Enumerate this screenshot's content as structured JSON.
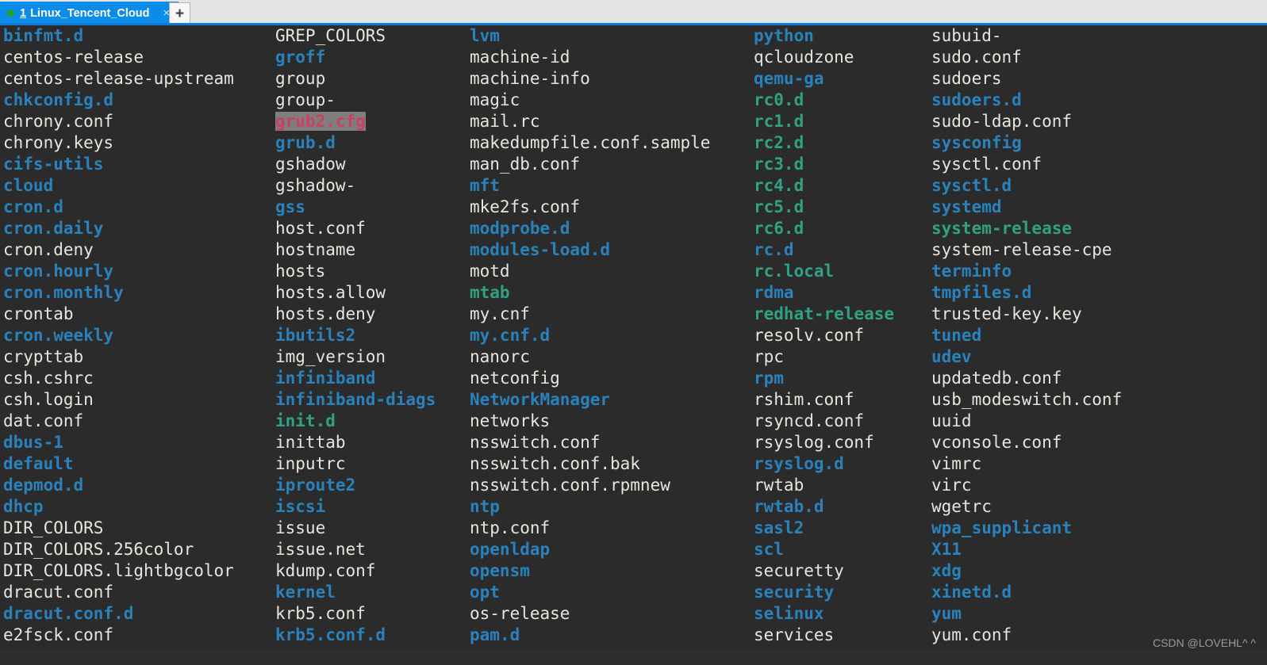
{
  "window": {
    "tab": {
      "index": "1",
      "title": "Linux_Tencent_Cloud",
      "close_label": "×",
      "status_dot_color": "#21a321"
    },
    "new_tab_label": "+",
    "accent_color": "#1179d6",
    "tabbar_bg": "#e4e4e4",
    "active_tab_bg": "#0c8ce9"
  },
  "terminal": {
    "background": "#2b2b2b",
    "colors": {
      "file": "#e9e5dd",
      "directory": "#2a82bc",
      "symlink": "#31a183",
      "orphan_text": "#c8415f",
      "orphan_background": "#7e7e7e"
    },
    "columns": [
      {
        "id": "column-1",
        "entries": [
          {
            "name": "binfmt.d",
            "type": "dir"
          },
          {
            "name": "centos-release",
            "type": "file"
          },
          {
            "name": "centos-release-upstream",
            "type": "file"
          },
          {
            "name": "chkconfig.d",
            "type": "dir"
          },
          {
            "name": "chrony.conf",
            "type": "file"
          },
          {
            "name": "chrony.keys",
            "type": "file"
          },
          {
            "name": "cifs-utils",
            "type": "dir"
          },
          {
            "name": "cloud",
            "type": "dir"
          },
          {
            "name": "cron.d",
            "type": "dir"
          },
          {
            "name": "cron.daily",
            "type": "dir"
          },
          {
            "name": "cron.deny",
            "type": "file"
          },
          {
            "name": "cron.hourly",
            "type": "dir"
          },
          {
            "name": "cron.monthly",
            "type": "dir"
          },
          {
            "name": "crontab",
            "type": "file"
          },
          {
            "name": "cron.weekly",
            "type": "dir"
          },
          {
            "name": "crypttab",
            "type": "file"
          },
          {
            "name": "csh.cshrc",
            "type": "file"
          },
          {
            "name": "csh.login",
            "type": "file"
          },
          {
            "name": "dat.conf",
            "type": "file"
          },
          {
            "name": "dbus-1",
            "type": "dir"
          },
          {
            "name": "default",
            "type": "dir"
          },
          {
            "name": "depmod.d",
            "type": "dir"
          },
          {
            "name": "dhcp",
            "type": "dir"
          },
          {
            "name": "DIR_COLORS",
            "type": "file"
          },
          {
            "name": "DIR_COLORS.256color",
            "type": "file"
          },
          {
            "name": "DIR_COLORS.lightbgcolor",
            "type": "file"
          },
          {
            "name": "dracut.conf",
            "type": "file"
          },
          {
            "name": "dracut.conf.d",
            "type": "dir"
          },
          {
            "name": "e2fsck.conf",
            "type": "file"
          }
        ]
      },
      {
        "id": "column-2",
        "entries": [
          {
            "name": "GREP_COLORS",
            "type": "file"
          },
          {
            "name": "groff",
            "type": "dir"
          },
          {
            "name": "group",
            "type": "file"
          },
          {
            "name": "group-",
            "type": "file"
          },
          {
            "name": "grub2.cfg",
            "type": "orphan"
          },
          {
            "name": "grub.d",
            "type": "dir"
          },
          {
            "name": "gshadow",
            "type": "file"
          },
          {
            "name": "gshadow-",
            "type": "file"
          },
          {
            "name": "gss",
            "type": "dir"
          },
          {
            "name": "host.conf",
            "type": "file"
          },
          {
            "name": "hostname",
            "type": "file"
          },
          {
            "name": "hosts",
            "type": "file"
          },
          {
            "name": "hosts.allow",
            "type": "file"
          },
          {
            "name": "hosts.deny",
            "type": "file"
          },
          {
            "name": "ibutils2",
            "type": "dir"
          },
          {
            "name": "img_version",
            "type": "file"
          },
          {
            "name": "infiniband",
            "type": "dir"
          },
          {
            "name": "infiniband-diags",
            "type": "dir"
          },
          {
            "name": "init.d",
            "type": "link"
          },
          {
            "name": "inittab",
            "type": "file"
          },
          {
            "name": "inputrc",
            "type": "file"
          },
          {
            "name": "iproute2",
            "type": "dir"
          },
          {
            "name": "iscsi",
            "type": "dir"
          },
          {
            "name": "issue",
            "type": "file"
          },
          {
            "name": "issue.net",
            "type": "file"
          },
          {
            "name": "kdump.conf",
            "type": "file"
          },
          {
            "name": "kernel",
            "type": "dir"
          },
          {
            "name": "krb5.conf",
            "type": "file"
          },
          {
            "name": "krb5.conf.d",
            "type": "dir"
          }
        ]
      },
      {
        "id": "column-3",
        "entries": [
          {
            "name": "lvm",
            "type": "dir"
          },
          {
            "name": "machine-id",
            "type": "file"
          },
          {
            "name": "machine-info",
            "type": "file"
          },
          {
            "name": "magic",
            "type": "file"
          },
          {
            "name": "mail.rc",
            "type": "file"
          },
          {
            "name": "makedumpfile.conf.sample",
            "type": "file"
          },
          {
            "name": "man_db.conf",
            "type": "file"
          },
          {
            "name": "mft",
            "type": "dir"
          },
          {
            "name": "mke2fs.conf",
            "type": "file"
          },
          {
            "name": "modprobe.d",
            "type": "dir"
          },
          {
            "name": "modules-load.d",
            "type": "dir"
          },
          {
            "name": "motd",
            "type": "file"
          },
          {
            "name": "mtab",
            "type": "link"
          },
          {
            "name": "my.cnf",
            "type": "file"
          },
          {
            "name": "my.cnf.d",
            "type": "dir"
          },
          {
            "name": "nanorc",
            "type": "file"
          },
          {
            "name": "netconfig",
            "type": "file"
          },
          {
            "name": "NetworkManager",
            "type": "dir"
          },
          {
            "name": "networks",
            "type": "file"
          },
          {
            "name": "nsswitch.conf",
            "type": "file"
          },
          {
            "name": "nsswitch.conf.bak",
            "type": "file"
          },
          {
            "name": "nsswitch.conf.rpmnew",
            "type": "file"
          },
          {
            "name": "ntp",
            "type": "dir"
          },
          {
            "name": "ntp.conf",
            "type": "file"
          },
          {
            "name": "openldap",
            "type": "dir"
          },
          {
            "name": "opensm",
            "type": "dir"
          },
          {
            "name": "opt",
            "type": "dir"
          },
          {
            "name": "os-release",
            "type": "file"
          },
          {
            "name": "pam.d",
            "type": "dir"
          }
        ]
      },
      {
        "id": "column-4",
        "entries": [
          {
            "name": "python",
            "type": "dir"
          },
          {
            "name": "qcloudzone",
            "type": "file"
          },
          {
            "name": "qemu-ga",
            "type": "dir"
          },
          {
            "name": "rc0.d",
            "type": "link"
          },
          {
            "name": "rc1.d",
            "type": "link"
          },
          {
            "name": "rc2.d",
            "type": "link"
          },
          {
            "name": "rc3.d",
            "type": "link"
          },
          {
            "name": "rc4.d",
            "type": "link"
          },
          {
            "name": "rc5.d",
            "type": "link"
          },
          {
            "name": "rc6.d",
            "type": "link"
          },
          {
            "name": "rc.d",
            "type": "dir"
          },
          {
            "name": "rc.local",
            "type": "link"
          },
          {
            "name": "rdma",
            "type": "dir"
          },
          {
            "name": "redhat-release",
            "type": "link"
          },
          {
            "name": "resolv.conf",
            "type": "file"
          },
          {
            "name": "rpc",
            "type": "file"
          },
          {
            "name": "rpm",
            "type": "dir"
          },
          {
            "name": "rshim.conf",
            "type": "file"
          },
          {
            "name": "rsyncd.conf",
            "type": "file"
          },
          {
            "name": "rsyslog.conf",
            "type": "file"
          },
          {
            "name": "rsyslog.d",
            "type": "dir"
          },
          {
            "name": "rwtab",
            "type": "file"
          },
          {
            "name": "rwtab.d",
            "type": "dir"
          },
          {
            "name": "sasl2",
            "type": "dir"
          },
          {
            "name": "scl",
            "type": "dir"
          },
          {
            "name": "securetty",
            "type": "file"
          },
          {
            "name": "security",
            "type": "dir"
          },
          {
            "name": "selinux",
            "type": "dir"
          },
          {
            "name": "services",
            "type": "file"
          }
        ]
      },
      {
        "id": "column-5",
        "entries": [
          {
            "name": "subuid-",
            "type": "file"
          },
          {
            "name": "sudo.conf",
            "type": "file"
          },
          {
            "name": "sudoers",
            "type": "file"
          },
          {
            "name": "sudoers.d",
            "type": "dir"
          },
          {
            "name": "sudo-ldap.conf",
            "type": "file"
          },
          {
            "name": "sysconfig",
            "type": "dir"
          },
          {
            "name": "sysctl.conf",
            "type": "file"
          },
          {
            "name": "sysctl.d",
            "type": "dir"
          },
          {
            "name": "systemd",
            "type": "dir"
          },
          {
            "name": "system-release",
            "type": "link"
          },
          {
            "name": "system-release-cpe",
            "type": "file"
          },
          {
            "name": "terminfo",
            "type": "dir"
          },
          {
            "name": "tmpfiles.d",
            "type": "dir"
          },
          {
            "name": "trusted-key.key",
            "type": "file"
          },
          {
            "name": "tuned",
            "type": "dir"
          },
          {
            "name": "udev",
            "type": "dir"
          },
          {
            "name": "updatedb.conf",
            "type": "file"
          },
          {
            "name": "usb_modeswitch.conf",
            "type": "file"
          },
          {
            "name": "uuid",
            "type": "file"
          },
          {
            "name": "vconsole.conf",
            "type": "file"
          },
          {
            "name": "vimrc",
            "type": "file"
          },
          {
            "name": "virc",
            "type": "file"
          },
          {
            "name": "wgetrc",
            "type": "file"
          },
          {
            "name": "wpa_supplicant",
            "type": "dir"
          },
          {
            "name": "X11",
            "type": "dir"
          },
          {
            "name": "xdg",
            "type": "dir"
          },
          {
            "name": "xinetd.d",
            "type": "dir"
          },
          {
            "name": "yum",
            "type": "dir"
          },
          {
            "name": "yum.conf",
            "type": "file"
          }
        ]
      }
    ]
  },
  "watermark": {
    "text": "CSDN @LOVEHL^ ^"
  }
}
